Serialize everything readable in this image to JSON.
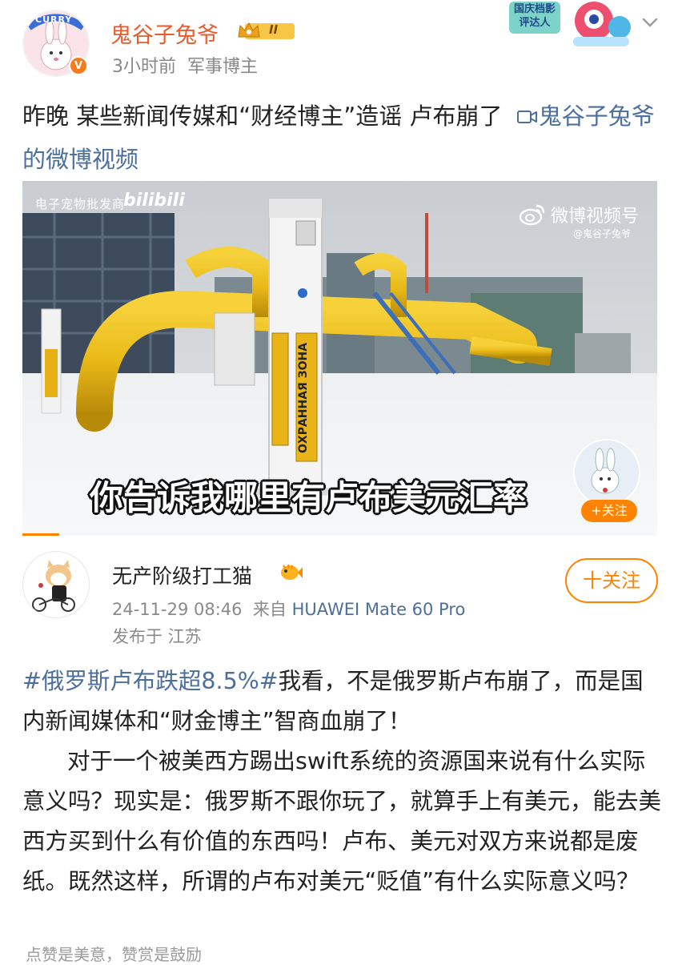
{
  "post1": {
    "author": "鬼谷子兔爷",
    "level_badge": "II",
    "time": "3小时前",
    "role": "军事博主",
    "text": "昨晚 某些新闻传媒和“财经博主”造谣 卢布崩了",
    "video_link": "鬼谷子兔爷的微博视频",
    "promo_badge": "国庆档影评达人",
    "avatar_text": "CURRY",
    "verified_mark": "V"
  },
  "video": {
    "top_left_tag": "电子宠物批发商",
    "bili_tag": "bilibili",
    "watermark": "微博视频号",
    "watermark_handle": "@鬼谷子兔爷",
    "subtitle": "你告诉我哪里有卢布美元汇率",
    "follow": "+关注",
    "sign_text": "ОХРАННАЯ ЗОНА"
  },
  "post2": {
    "author": "无产阶级打工猫",
    "follow": "十关注",
    "date": "24-11-29 08:46",
    "source_prefix": "来自",
    "device": "HUAWEI Mate 60 Pro",
    "location": "发布于 江苏",
    "hashtag": "#俄罗斯卢布跌超8.5%#",
    "para1": "我看，不是俄罗斯卢布崩了，而是国内新闻媒体和“财金博主”智商血崩了！",
    "para2": "对于一个被美西方踢出swift系统的资源国来说有什么实际意义吗？现实是：俄罗斯不跟你玩了，就算手上有美元，能去美西方买到什么有价值的东西吗！卢布、美元对双方来说都是废纸。既然这样，所谓的卢布对美元“贬值”有什么实际意义吗？"
  },
  "footer": "点赞是美意，赞赏是鼓励",
  "colors": {
    "accent_orange": "#ff8200",
    "name_orange": "#eb5a2a",
    "link_blue": "#4c6f9b",
    "meta_gray": "#888888"
  },
  "icons": [
    "crown-badge-icon",
    "chevron-down-icon",
    "video-link-icon",
    "weibo-logo-icon",
    "fish-badge-icon"
  ]
}
